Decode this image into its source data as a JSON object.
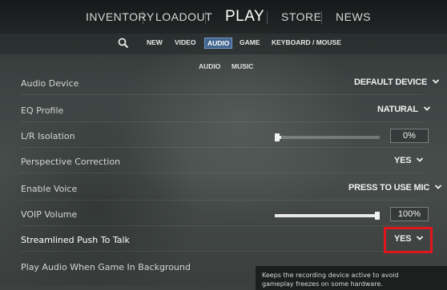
{
  "topnav": {
    "inventory": "INVENTORY",
    "loadout": "LOADOUT",
    "play": "PLAY",
    "store": "STORE",
    "news": "NEWS"
  },
  "subnav": {
    "new": "NEW",
    "video": "VIDEO",
    "audio": "AUDIO",
    "game": "GAME",
    "keyboard_mouse": "KEYBOARD / MOUSE"
  },
  "tier2": {
    "audio": "AUDIO",
    "music": "MUSIC"
  },
  "settings": {
    "audio_device": {
      "label": "Audio Device",
      "value": "DEFAULT DEVICE"
    },
    "eq_profile": {
      "label": "EQ Profile",
      "value": "NATURAL"
    },
    "lr_isolation": {
      "label": "L/R Isolation",
      "value": "0%",
      "level": 0
    },
    "perspective_correction": {
      "label": "Perspective Correction",
      "value": "YES"
    },
    "enable_voice": {
      "label": "Enable Voice",
      "value": "PRESS TO USE MIC"
    },
    "voip_volume": {
      "label": "VOIP Volume",
      "value": "100%",
      "level": 100
    },
    "streamlined_ptt": {
      "label": "Streamlined Push To Talk",
      "value": "YES"
    },
    "play_audio_bg": {
      "label": "Play Audio When Game In Background"
    }
  },
  "tooltip": {
    "line1": "Keeps the recording device active to avoid",
    "line2": "gameplay freezes on some hardware."
  },
  "colors": {
    "highlight_box": "#e0161c",
    "active_tab": "#466ea0"
  }
}
